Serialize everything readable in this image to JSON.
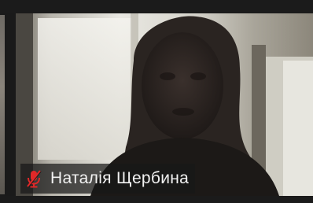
{
  "participant": {
    "name": "Наталія Щербина",
    "muted": true,
    "mic_icon": "microphone-muted-icon"
  },
  "colors": {
    "mute_red": "#e02828",
    "name_text": "#f2f2f2",
    "name_bar_bg": "#181818"
  }
}
